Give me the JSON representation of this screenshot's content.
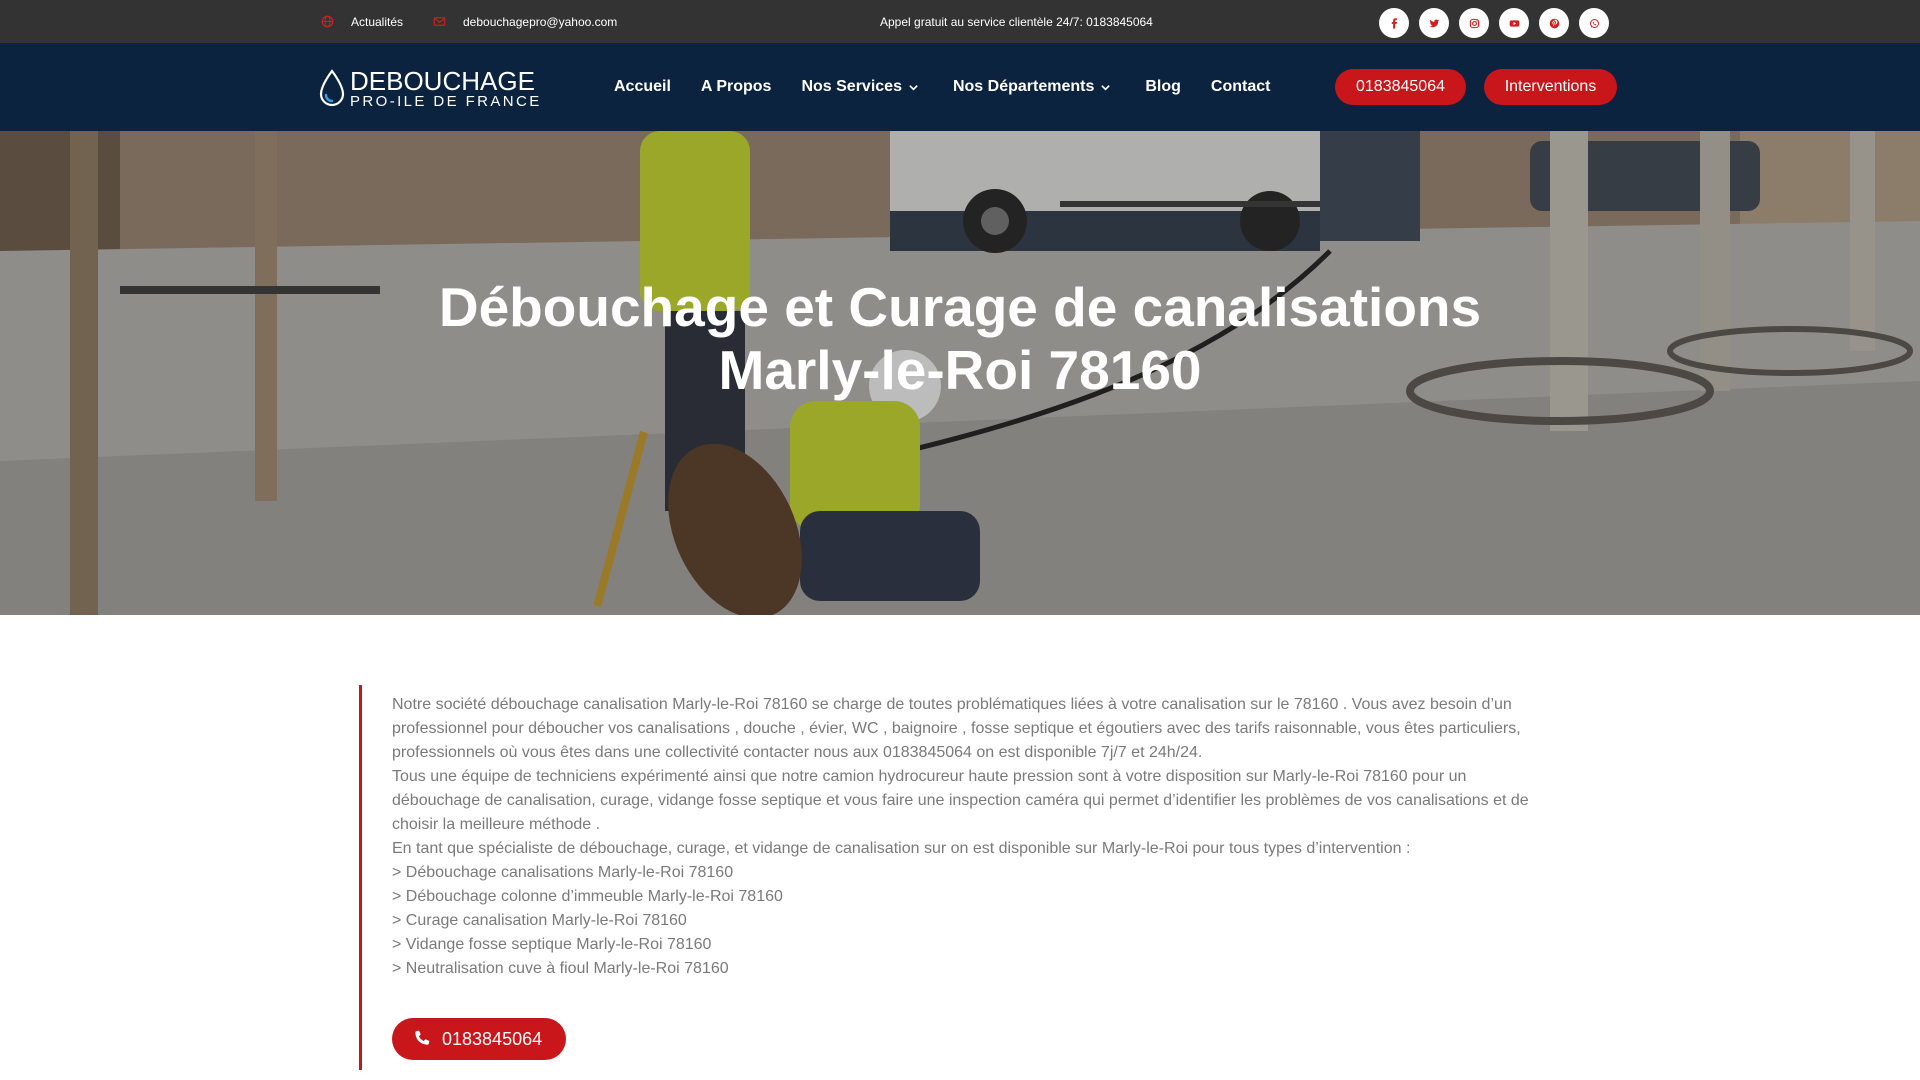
{
  "topbar": {
    "news_label": "Actualités",
    "email": "debouchagepro@yahoo.com",
    "hotline": "Appel gratuit au service clientèle 24/7: 0183845064",
    "socials": [
      "facebook-icon",
      "twitter-icon",
      "instagram-icon",
      "youtube-icon",
      "pinterest-icon",
      "whatsapp-icon"
    ]
  },
  "header": {
    "logo_line1": "DEBOUCHAGE",
    "logo_line2": "PRO-ILE DE FRANCE",
    "nav": [
      {
        "label": "Accueil"
      },
      {
        "label": "A Propos"
      },
      {
        "label": "Nos Services"
      },
      {
        "label": "Nos Départements"
      },
      {
        "label": "Blog"
      },
      {
        "label": "Contact"
      }
    ],
    "phone_button": "0183845064",
    "interventions_button": "Interventions"
  },
  "hero": {
    "title_line1": "Débouchage et Curage de canalisations",
    "title_line2": "Marly-le-Roi 78160"
  },
  "content": {
    "paragraphs": [
      "Notre société débouchage canalisation Marly-le-Roi 78160 se charge de toutes problématiques liées à votre canalisation sur le 78160 . Vous avez besoin d’un professionnel pour déboucher vos canalisations , douche , évier, WC , baignoire , fosse septique et égoutiers avec des tarifs raisonnable, vous êtes particuliers, professionnels où vous êtes dans une collectivité contacter nous aux 0183845064 on est disponible 7j/7 et 24h/24.",
      "Tous une équipe de techniciens expérimenté ainsi que notre camion hydrocureur haute pression sont à votre disposition sur Marly-le-Roi 78160 pour un débouchage de canalisation, curage, vidange fosse septique et vous faire une inspection caméra qui permet d’identifier les problèmes de vos canalisations et de choisir la meilleure méthode .",
      "En tant que spécialiste de débouchage, curage, et vidange de canalisation sur on est disponible sur Marly-le-Roi pour tous types d’intervention :"
    ],
    "services": [
      "> Débouchage canalisations Marly-le-Roi 78160",
      "> Débouchage colonne d’immeuble Marly-le-Roi 78160",
      "> Curage canalisation Marly-le-Roi 78160",
      "> Vidange fosse septique Marly-le-Roi 78160",
      "> Neutralisation cuve à fioul Marly-le-Roi 78160"
    ],
    "call_button": "0183845064"
  },
  "colors": {
    "accent": "#c8161b",
    "header_bg": "#0c2340",
    "topbar_bg": "#333333",
    "text": "#7a7a7a"
  }
}
